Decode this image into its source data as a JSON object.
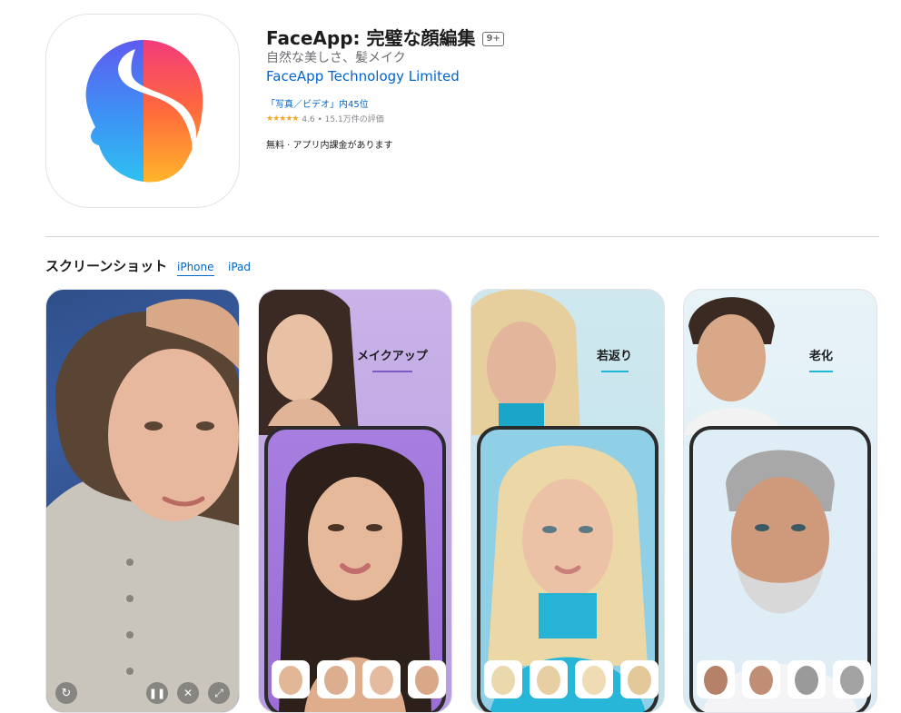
{
  "app": {
    "title": "FaceApp: 完璧な顔編集",
    "age_rating": "9+",
    "subtitle": "自然な美しさ、髪メイク",
    "developer": "FaceApp Technology Limited",
    "rank": "「写真／ビデオ」内45位",
    "stars": "★★★★★",
    "rating": "4.6 • 15.1万件の評価",
    "price": "無料 · アプリ内課金があります"
  },
  "screenshots": {
    "section_title": "スクリーンショット",
    "tabs": [
      "iPhone",
      "iPad"
    ],
    "captions": [
      "メイクアップ",
      "若返り",
      "老化"
    ]
  },
  "colors": {
    "link": "#0066cc",
    "accent_purple": "#7c5cc4",
    "accent_cyan": "#1fb7d8"
  }
}
